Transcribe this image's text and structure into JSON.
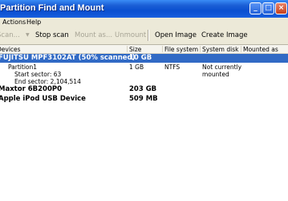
{
  "window": {
    "title": "Partition Find and Mount"
  },
  "menubar": {
    "items": [
      "Actions",
      "Help"
    ]
  },
  "toolbar": {
    "scan": "Scan...",
    "stop_scan": "Stop scan",
    "mount_as": "Mount as...",
    "unmount": "Unmount",
    "open_image": "Open Image",
    "create_image": "Create Image"
  },
  "columns": [
    "Devices",
    "Size",
    "File system",
    "System disk",
    "Mounted as"
  ],
  "rows": [
    {
      "name": "FUJITSU MPF3102AT  (50% scanned)",
      "size": "10 GB"
    },
    {
      "name": "Partition1",
      "start": "Start sector: 63",
      "end": "End sector: 2,104,514",
      "size": "1 GB",
      "fs": "NTFS",
      "sys_line1": "Not currently",
      "sys_line2": "mounted"
    },
    {
      "name": "Maxtor 6B200P0",
      "size": "203 GB"
    },
    {
      "name": "Apple iPod USB Device",
      "size": "509 MB"
    }
  ]
}
